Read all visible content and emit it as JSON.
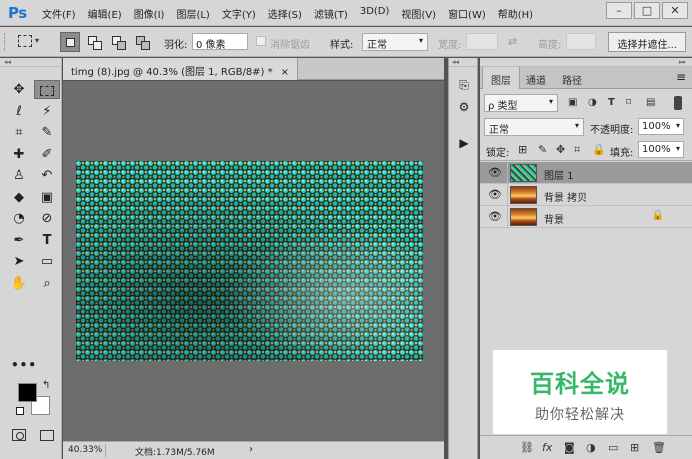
{
  "app": {
    "logo": "Ps"
  },
  "menu": [
    "文件(F)",
    "编辑(E)",
    "图像(I)",
    "图层(L)",
    "文字(Y)",
    "选择(S)",
    "滤镜(T)",
    "3D(D)",
    "视图(V)",
    "窗口(W)",
    "帮助(H)"
  ],
  "window_controls": {
    "minimize": "–",
    "maximize": "□",
    "close": "✕"
  },
  "options": {
    "feather_label": "羽化:",
    "feather_value": "0 像素",
    "antialias_label": "消除锯齿",
    "style_label": "样式:",
    "style_value": "正常",
    "width_label": "宽度:",
    "height_label": "高度:",
    "select_mask_button": "选择并遮住..."
  },
  "document": {
    "tab_title": "timg (8).jpg @ 40.3% (图层 1, RGB/8#) *",
    "tab_close": "×",
    "zoom": "40.33%",
    "doc_info": "文档:1.73M/5.76M",
    "status_arrow": "›"
  },
  "layers_panel": {
    "tabs": [
      "图层",
      "通道",
      "路径"
    ],
    "active_tab": 0,
    "filter_kind": "ρ 类型",
    "blend_mode": "正常",
    "opacity_label": "不透明度:",
    "opacity_value": "100%",
    "lock_label": "锁定:",
    "fill_label": "填充:",
    "fill_value": "100%",
    "layers": [
      {
        "name": "图层 1",
        "thumb": "teal",
        "selected": true,
        "locked": false
      },
      {
        "name": "背景 拷贝",
        "thumb": "fire",
        "selected": false,
        "locked": false
      },
      {
        "name": "背景",
        "thumb": "fire",
        "selected": false,
        "locked": true
      }
    ]
  },
  "watermark": {
    "title": "百科全说",
    "subtitle": "助你轻松解决"
  },
  "colors": {
    "foreground": "#000000",
    "background": "#ffffff",
    "accent": "#1b76d2",
    "watermark_green": "#35b86a"
  }
}
